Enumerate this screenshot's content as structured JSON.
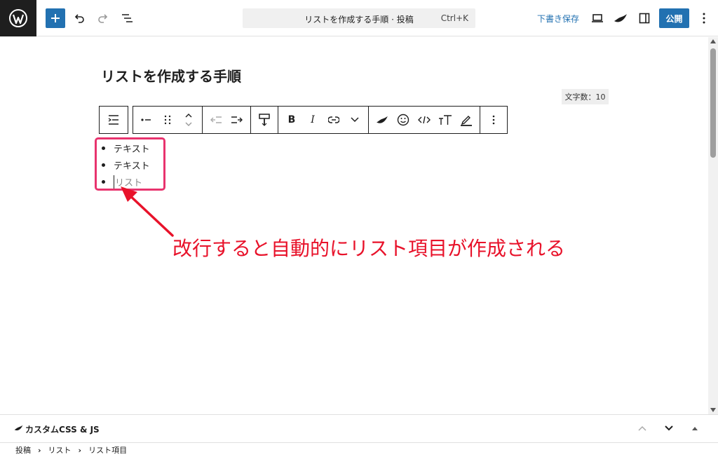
{
  "topbar": {
    "document_title": "リストを作成する手順 · 投稿",
    "shortcut": "Ctrl+K",
    "save_draft": "下書き保存",
    "publish": "公開"
  },
  "editor": {
    "post_title": "リストを作成する手順",
    "char_count": "文字数：10",
    "list_items": [
      "テキスト",
      "テキスト"
    ],
    "list_placeholder": "リスト"
  },
  "annotation": "改行すると自動的にリスト項目が作成される",
  "bottom_panel": {
    "title": "カスタムCSS & JS"
  },
  "breadcrumb": [
    "投稿",
    "リスト",
    "リスト項目"
  ],
  "colors": {
    "accent": "#2271b1",
    "highlight": "#e8336e",
    "annotation": "#e8122a"
  }
}
